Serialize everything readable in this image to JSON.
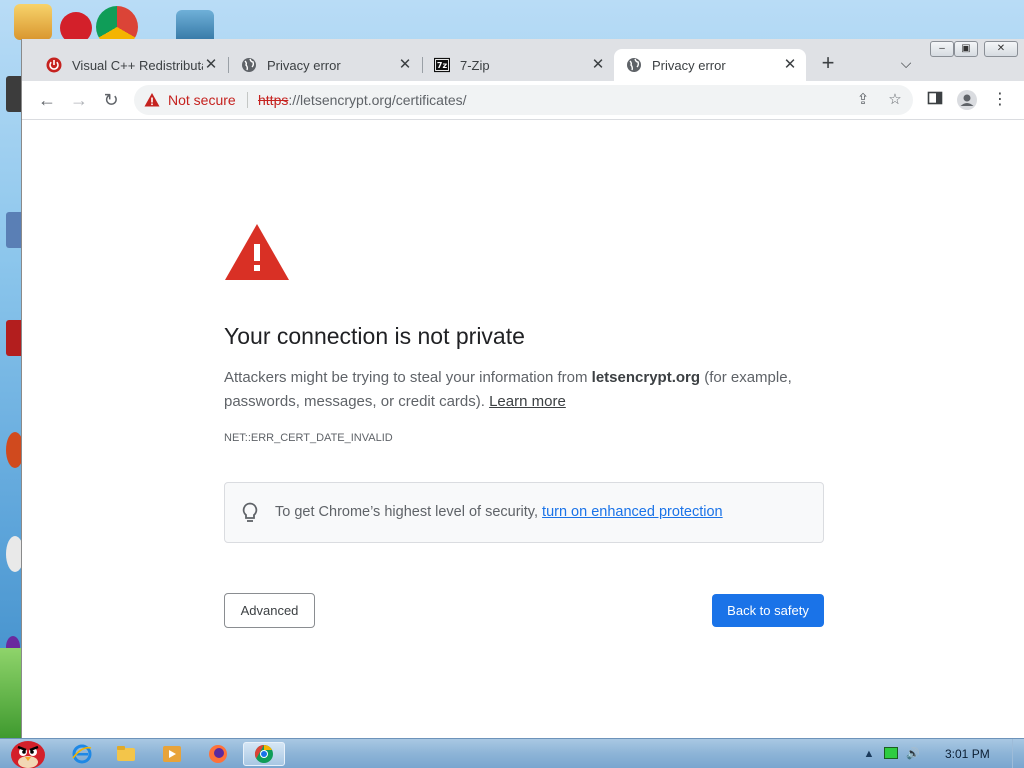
{
  "browser": {
    "tabs": [
      {
        "title": "Visual C++ Redistributable",
        "favicon": "power-red-icon",
        "active": false
      },
      {
        "title": "Privacy error",
        "favicon": "globe-icon",
        "active": false
      },
      {
        "title": "7-Zip",
        "favicon": "7zip-icon",
        "active": false
      },
      {
        "title": "Privacy error",
        "favicon": "globe-icon",
        "active": true
      }
    ],
    "new_tab_label": "+",
    "address_bar": {
      "security_label": "Not secure",
      "url_scheme": "https",
      "url_rest": "://letsencrypt.org/certificates/"
    }
  },
  "error_page": {
    "heading": "Your connection is not private",
    "description_prefix": "Attackers might be trying to steal your information from ",
    "domain": "letsencrypt.org",
    "description_suffix": " (for example, passwords, messages, or credit cards). ",
    "learn_more": "Learn more",
    "error_code": "NET::ERR_CERT_DATE_INVALID",
    "tip_text": "To get Chrome’s highest level of security, ",
    "tip_link": "turn on enhanced protection",
    "advanced_button": "Advanced",
    "back_button": "Back to safety"
  },
  "taskbar": {
    "clock": "3:01 PM"
  },
  "colors": {
    "danger": "#c5221f",
    "primary": "#1a73e8",
    "warning_triangle": "#d93025"
  }
}
